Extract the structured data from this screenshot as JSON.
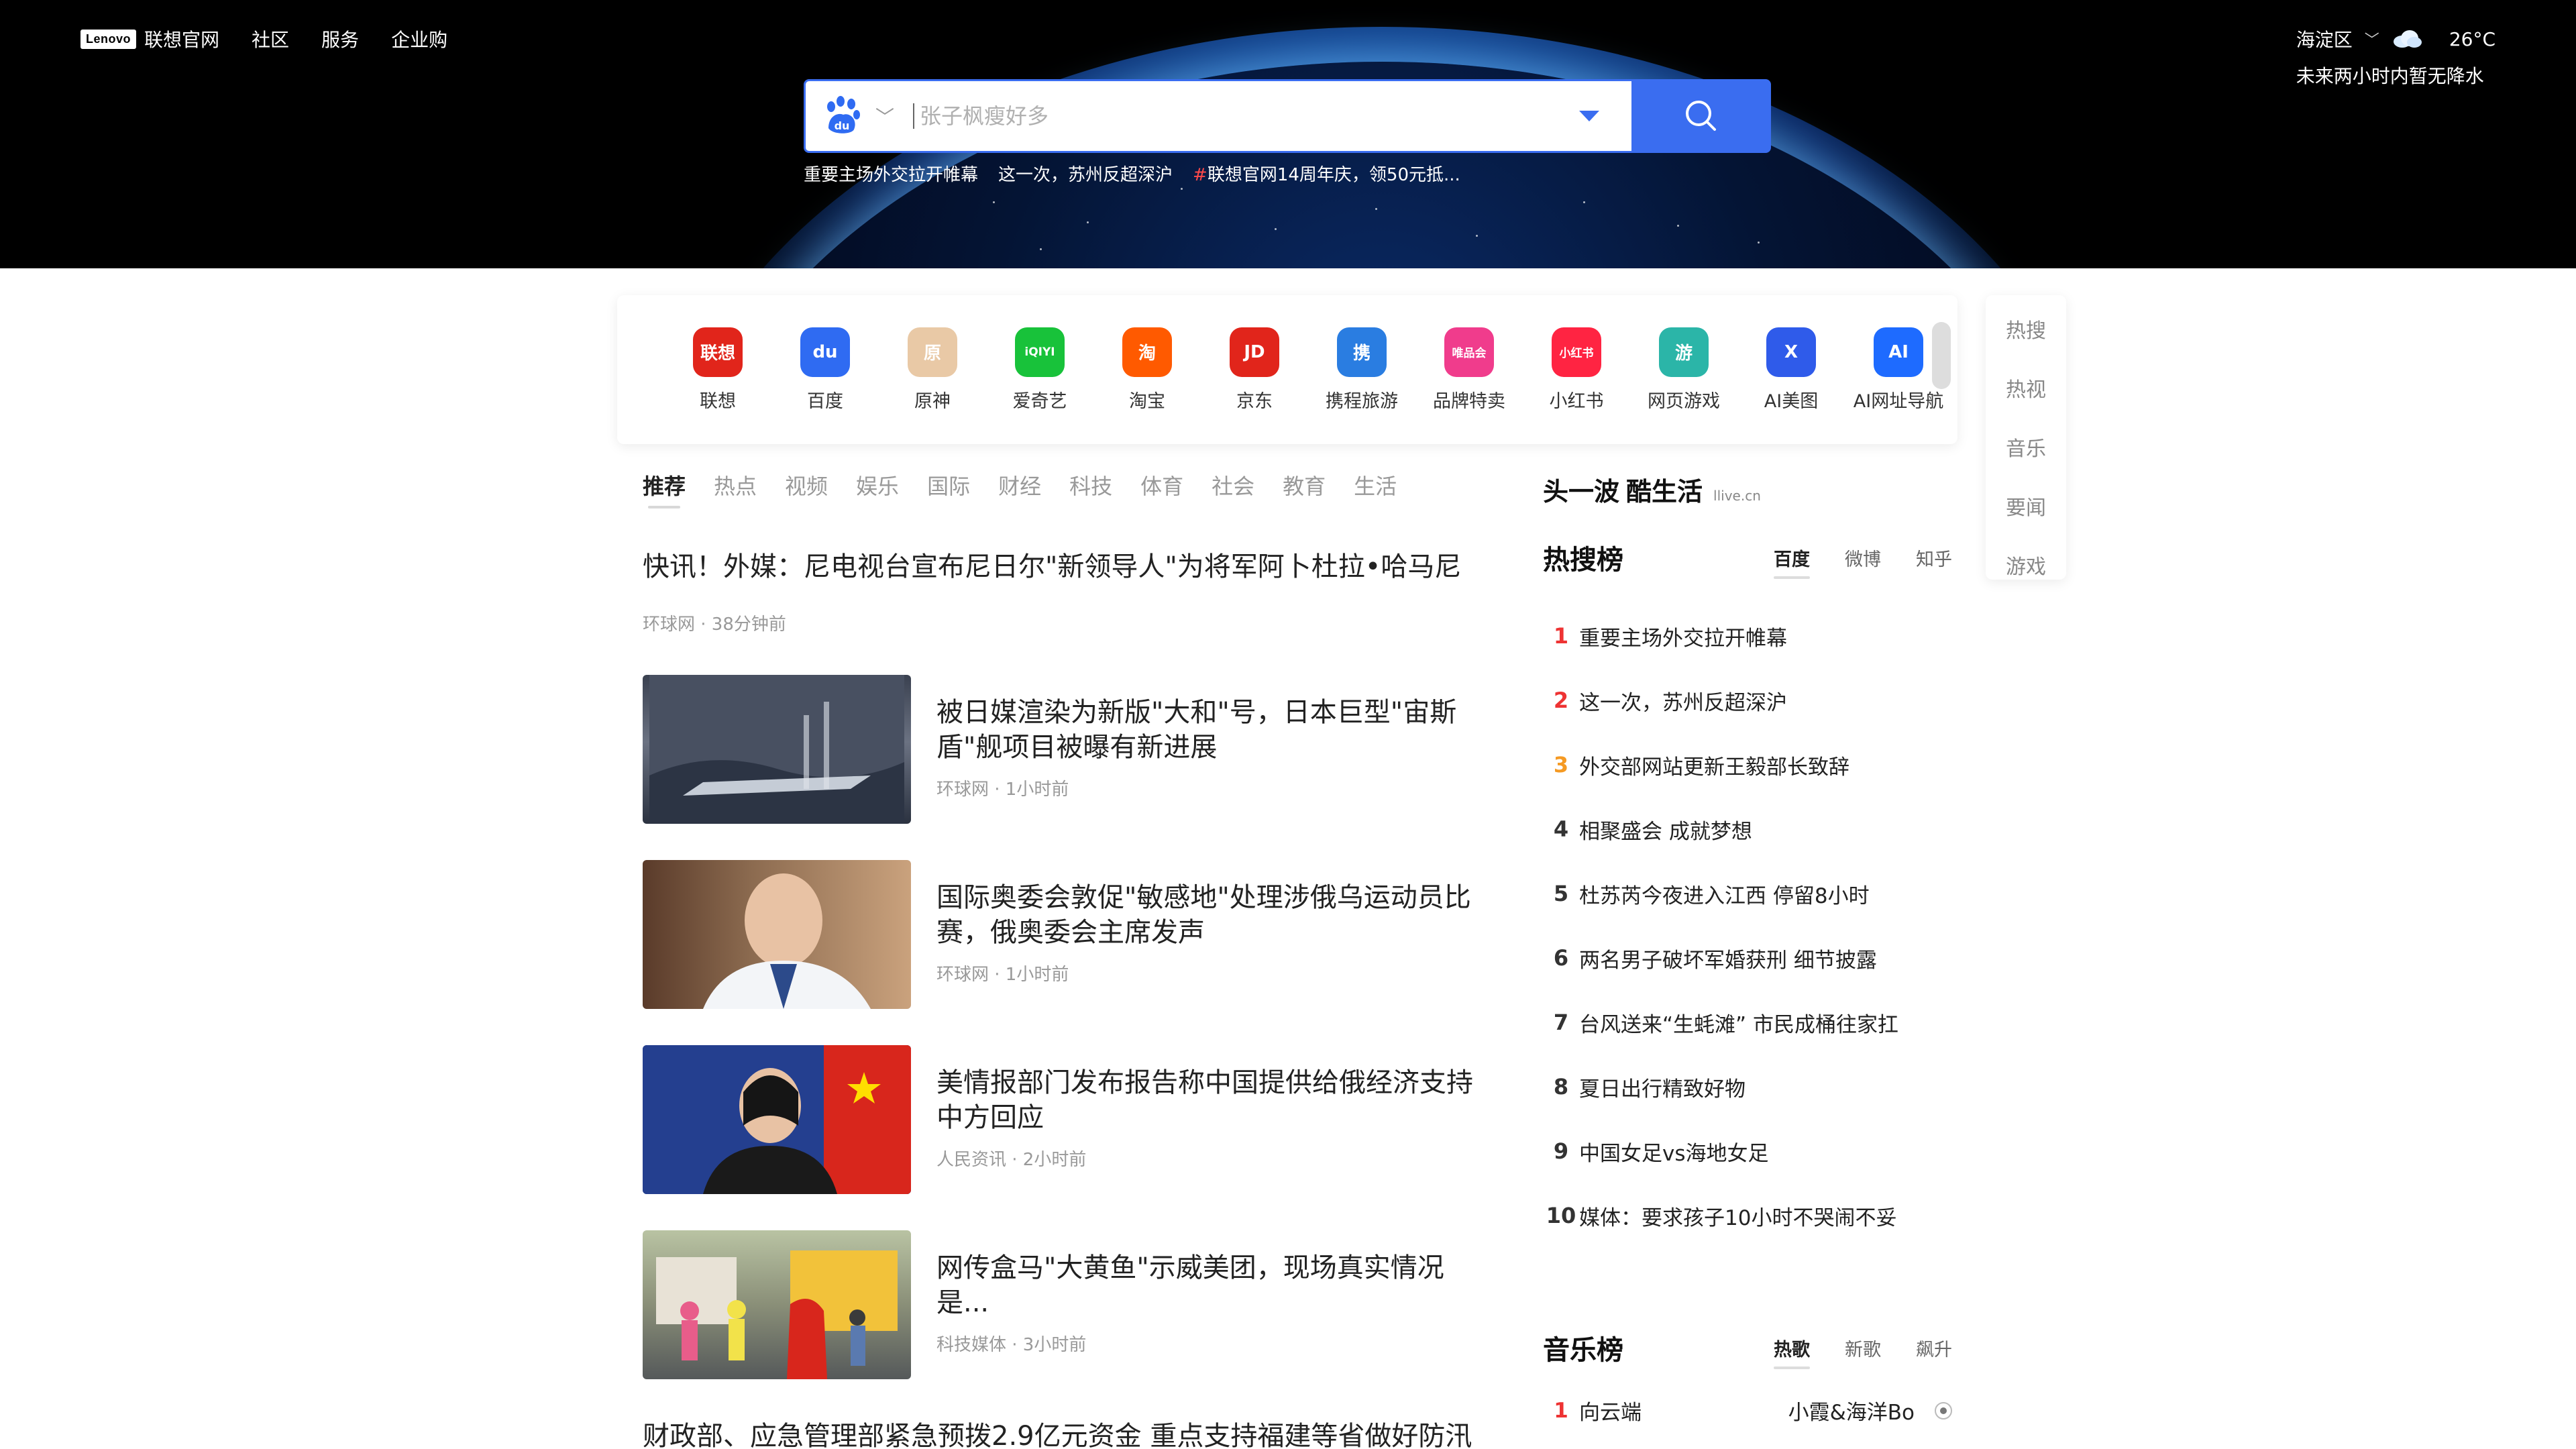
{
  "topnav": {
    "logo": "Lenovo",
    "brand": "联想官网",
    "links": [
      "社区",
      "服务",
      "企业购"
    ]
  },
  "weather": {
    "location": "海淀区",
    "temp": "26°C",
    "note": "未来两小时内暂无降水",
    "icon": "cloud-icon"
  },
  "search": {
    "placeholder": "张子枫瘦好多",
    "engine": "baidu",
    "hotwords": [
      "重要主场外交拉开帷幕",
      "这一次，苏州反超深沪",
      "联想官网14周年庆，领50元抵..."
    ]
  },
  "apps": [
    {
      "label": "联想",
      "icon_text": "联想",
      "color": "#e1251b"
    },
    {
      "label": "百度",
      "icon_text": "du",
      "color": "#2f6bf2"
    },
    {
      "label": "原神",
      "icon_text": "原",
      "color": "#e9c9a6"
    },
    {
      "label": "爱奇艺",
      "icon_text": "iQIYI",
      "color": "#18c23a"
    },
    {
      "label": "淘宝",
      "icon_text": "淘",
      "color": "#ff5a00"
    },
    {
      "label": "京东",
      "icon_text": "JD",
      "color": "#e1251b"
    },
    {
      "label": "携程旅游",
      "icon_text": "携",
      "color": "#2a7de1"
    },
    {
      "label": "品牌特卖",
      "icon_text": "唯品会",
      "color": "#f03c8c"
    },
    {
      "label": "小红书",
      "icon_text": "小红书",
      "color": "#ff2442"
    },
    {
      "label": "网页游戏",
      "icon_text": "游",
      "color": "#2bb5a8"
    },
    {
      "label": "AI美图",
      "icon_text": "X",
      "color": "#2f5bea"
    },
    {
      "label": "AI网址导航",
      "icon_text": "AI",
      "color": "#1e6bff"
    }
  ],
  "side_nav": [
    "热搜",
    "热视",
    "音乐",
    "要闻",
    "游戏"
  ],
  "news": {
    "tabs": [
      "推荐",
      "热点",
      "视频",
      "娱乐",
      "国际",
      "财经",
      "科技",
      "体育",
      "社会",
      "教育",
      "生活"
    ],
    "active_tab": "推荐",
    "top": {
      "title": "快讯！外媒：尼电视台宣布尼日尔\"新领导人\"为将军阿卜杜拉•哈马尼",
      "meta": "环球网 · 38分钟前"
    },
    "items": [
      {
        "title": "被日媒渲染为新版\"大和\"号，日本巨型\"宙斯盾\"舰项目被曝有新进展",
        "meta": "环球网 · 1小时前"
      },
      {
        "title": "国际奥委会敦促\"敏感地\"处理涉俄乌运动员比赛，俄奥委会主席发声",
        "meta": "环球网 · 1小时前"
      },
      {
        "title": "美情报部门发布报告称中国提供给俄经济支持 中方回应",
        "meta": "人民资讯 · 2小时前"
      },
      {
        "title": "网传盒马\"大黄鱼\"示威美团，现场真实情况是...",
        "meta": "科技媒体 · 3小时前"
      }
    ],
    "last_title": "财政部、应急管理部紧急预拨2.9亿元资金 重点支持福建等省做好防汛"
  },
  "right": {
    "brand_a": "头一波",
    "brand_b": "酷生活",
    "brand_c": "llive.cn",
    "hot": {
      "title": "热搜榜",
      "tabs": [
        "百度",
        "微博",
        "知乎"
      ],
      "items": [
        "重要主场外交拉开帷幕",
        "这一次，苏州反超深沪",
        "外交部网站更新王毅部长致辞",
        "相聚盛会 成就梦想",
        "杜苏芮今夜进入江西 停留8小时",
        "两名男子破坏军婚获刑 细节披露",
        "台风送来“生蚝滩” 市民成桶往家扛",
        "夏日出行精致好物",
        "中国女足vs海地女足",
        "媒体：要求孩子10小时不哭闹不妥"
      ]
    },
    "music": {
      "title": "音乐榜",
      "tabs": [
        "热歌",
        "新歌",
        "飙升"
      ],
      "first": {
        "rank": "1",
        "song": "向云端",
        "artist": "小霞&海洋Bo"
      }
    }
  }
}
